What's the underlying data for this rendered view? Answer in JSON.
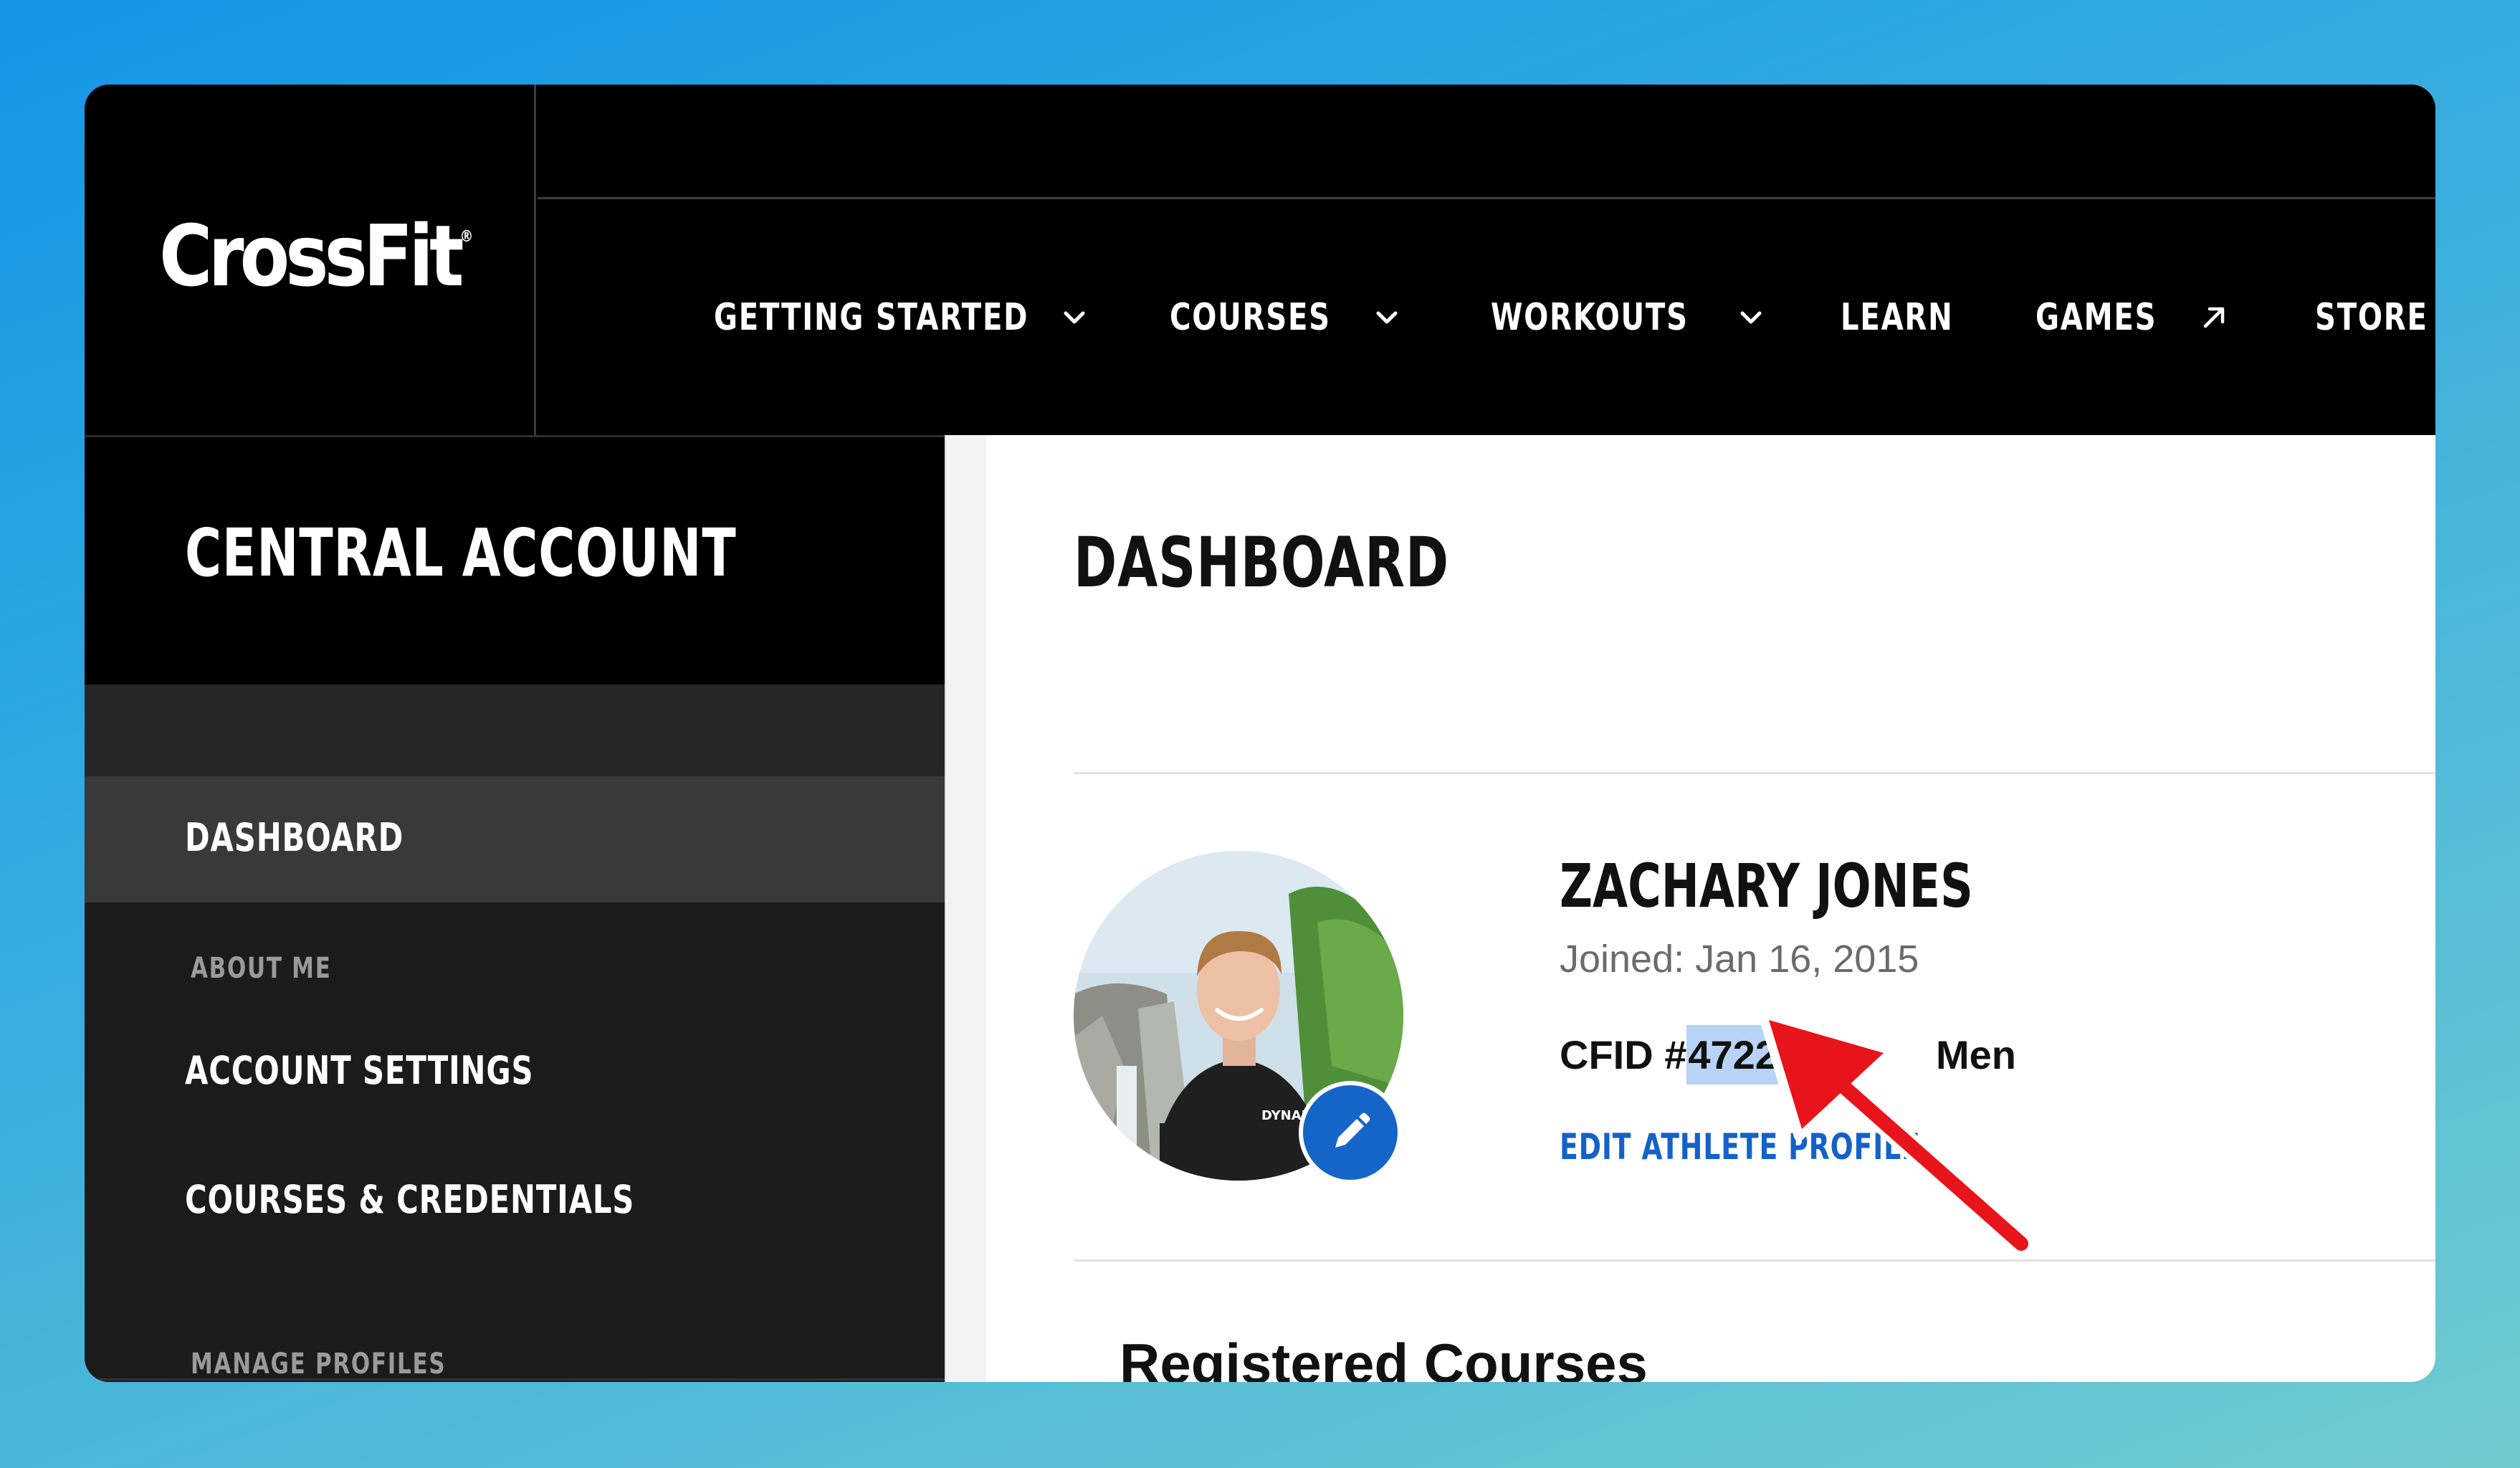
{
  "header": {
    "logo_text": "CrossFit",
    "logo_mark": "®",
    "nav": [
      {
        "label": "GETTING STARTED",
        "icon": "chevron-down-icon"
      },
      {
        "label": "COURSES",
        "icon": "chevron-down-icon"
      },
      {
        "label": "WORKOUTS",
        "icon": "chevron-down-icon"
      },
      {
        "label": "LEARN"
      },
      {
        "label": "GAMES",
        "icon": "external-link-icon"
      },
      {
        "label": "STORE",
        "icon": "external-link-icon"
      }
    ]
  },
  "sidebar": {
    "title": "CENTRAL ACCOUNT",
    "items": [
      {
        "label": "DASHBOARD",
        "active": true
      },
      {
        "section": "ABOUT ME"
      },
      {
        "label": "ACCOUNT SETTINGS"
      },
      {
        "label": "COURSES & CREDENTIALS"
      },
      {
        "section": "MANAGE PROFILES"
      }
    ]
  },
  "main": {
    "title": "DASHBOARD",
    "profile": {
      "name": "ZACHARY JONES",
      "joined": "Joined: Jan 16, 2015",
      "cfid_prefix": "CFID #",
      "cfid_number": "472243",
      "division": "Men",
      "edit_link": "EDIT ATHLETE PROFILE",
      "avatar_shirt_text": "DYNAM"
    },
    "registered_courses_title": "Registered Courses"
  },
  "colors": {
    "accent_blue": "#1462c8",
    "highlight": "#b7d3f5",
    "arrow_red": "#e8141c",
    "header_bg": "#000000",
    "sidebar_bg": "#1b1b1b"
  }
}
